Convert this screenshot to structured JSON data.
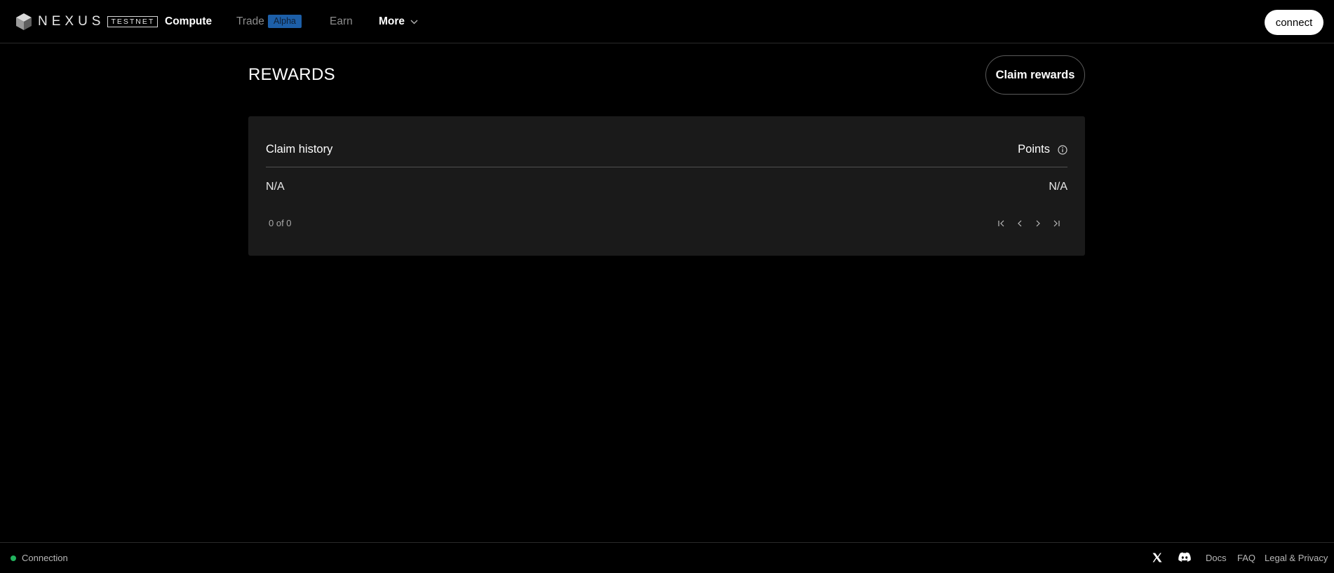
{
  "brand": {
    "name": "NEXUS",
    "badge": "TESTNET"
  },
  "nav": {
    "compute": "Compute",
    "trade": "Trade",
    "trade_badge": "Alpha",
    "earn": "Earn",
    "more": "More"
  },
  "header": {
    "connect_label": "connect"
  },
  "page": {
    "title": "REWARDS",
    "claim_button": "Claim rewards"
  },
  "table": {
    "columns": [
      "Claim history",
      "Points"
    ],
    "rows": [
      [
        "N/A",
        "N/A"
      ]
    ],
    "pagination": "0 of 0"
  },
  "footer": {
    "status": "Connection",
    "status_color": "#22b35e",
    "links": [
      "Docs",
      "FAQ",
      "Legal & Privacy"
    ],
    "icons": [
      "x-icon",
      "discord-icon"
    ]
  },
  "colors": {
    "background": "#000000",
    "panel": "#1a1a1a",
    "accent_badge": "#1d5fa8"
  }
}
